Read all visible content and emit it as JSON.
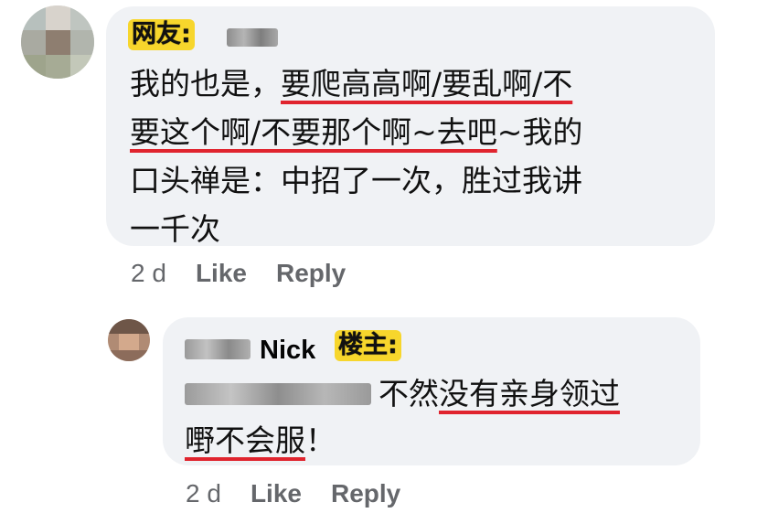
{
  "comment1": {
    "tag": "网友:",
    "lines": [
      [
        "我的也是，",
        "要爬高高啊/要乱啊/不"
      ],
      [
        "要这个啊/不要那个啊~去吧",
        "~我的"
      ],
      [
        "口头禅是：中招了一次，胜过我讲"
      ],
      [
        "一千次"
      ]
    ],
    "time": "2 d",
    "like": "Like",
    "reply": "Reply"
  },
  "comment2": {
    "name_visible": "Nick",
    "tag": "楼主:",
    "text_plain": "不然",
    "text_underlined_1": "没有亲身领过",
    "text_underlined_2": "嘢不会服",
    "text_tail": "！",
    "time": "2 d",
    "like": "Like",
    "reply": "Reply"
  },
  "colors": {
    "bubble": "#f0f2f5",
    "tag_bg": "#f7d62c",
    "underline": "#e0242e",
    "meta": "#65676b"
  }
}
